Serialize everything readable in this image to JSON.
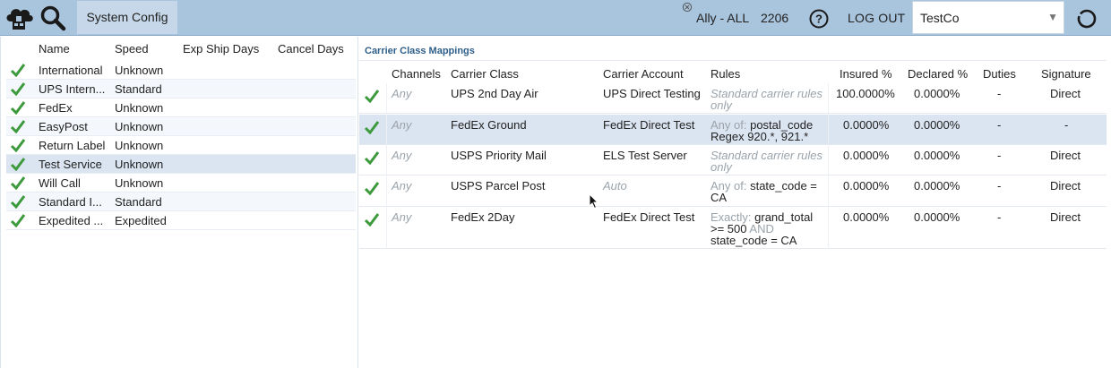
{
  "topbar": {
    "system_config": "System Config",
    "user": "Ally - ALL",
    "count": "2206",
    "logout": "LOG OUT",
    "company": "TestCo",
    "colors": {
      "bar": "#a9c4dd",
      "accent": "#2e5f8a",
      "check": "#3c9a3c"
    },
    "icons": [
      "cloud-logo-icon",
      "search-icon",
      "close-icon",
      "help-icon",
      "chevron-down-icon",
      "refresh-icon"
    ]
  },
  "services": {
    "columns": [
      "Name",
      "Speed",
      "Exp Ship Days",
      "Cancel Days"
    ],
    "rows": [
      {
        "name": "International",
        "speed": "Unknown"
      },
      {
        "name": "UPS Intern...",
        "speed": "Standard"
      },
      {
        "name": "FedEx",
        "speed": "Unknown"
      },
      {
        "name": "EasyPost",
        "speed": "Unknown"
      },
      {
        "name": "Return Label",
        "speed": "Unknown"
      },
      {
        "name": "Test Service",
        "speed": "Unknown"
      },
      {
        "name": "Will Call",
        "speed": "Unknown"
      },
      {
        "name": "Standard I...",
        "speed": "Standard"
      },
      {
        "name": "Expedited ...",
        "speed": "Expedited"
      }
    ]
  },
  "mappings": {
    "title": "Carrier Class Mappings",
    "columns": [
      "Channels",
      "Carrier Class",
      "Carrier Account",
      "Rules",
      "Insured %",
      "Declared %",
      "Duties",
      "Signature"
    ],
    "rows": [
      {
        "channels": "Any",
        "carrier_class": "UPS 2nd Day Air",
        "carrier_account": "UPS Direct Testing",
        "rule_note": "Standard carrier rules only",
        "insured": "100.0000%",
        "declared": "0.0000%",
        "duties": "-",
        "signature": "Direct"
      },
      {
        "channels": "Any",
        "carrier_class": "FedEx Ground",
        "carrier_account": "FedEx Direct Test",
        "rule_prefix": "Any of:",
        "rule_text1": "postal_code",
        "rule_text2": "Regex 920.*, 921.*",
        "insured": "0.0000%",
        "declared": "0.0000%",
        "duties": "-",
        "signature": "-"
      },
      {
        "channels": "Any",
        "carrier_class": "USPS Priority Mail",
        "carrier_account": "ELS Test Server",
        "rule_note": "Standard carrier rules only",
        "insured": "0.0000%",
        "declared": "0.0000%",
        "duties": "-",
        "signature": "Direct"
      },
      {
        "channels": "Any",
        "carrier_class": "USPS Parcel Post",
        "carrier_account": "Auto",
        "rule_prefix": "Any of:",
        "rule_text1": "state_code =",
        "rule_text2": "CA",
        "insured": "0.0000%",
        "declared": "0.0000%",
        "duties": "-",
        "signature": "Direct"
      },
      {
        "channels": "Any",
        "carrier_class": "FedEx 2Day",
        "carrier_account": "FedEx Direct Test",
        "rule_prefix": "Exactly:",
        "rule_text1": "grand_total",
        "rule_text2": ">= 500",
        "rule_and": "AND",
        "rule_text3": "state_code = CA",
        "insured": "0.0000%",
        "declared": "0.0000%",
        "duties": "-",
        "signature": "Direct"
      }
    ]
  }
}
